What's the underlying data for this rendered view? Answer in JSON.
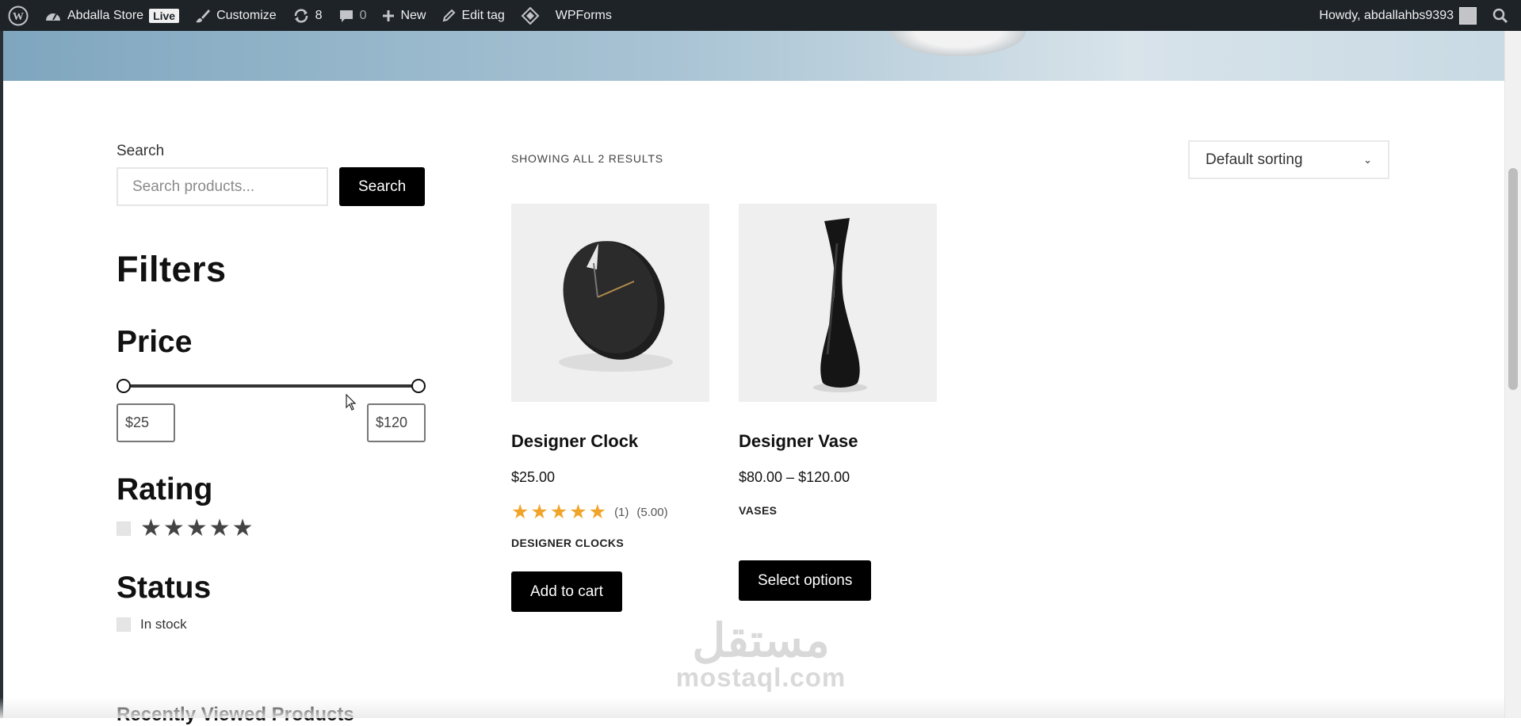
{
  "admin_bar": {
    "site_name": "Abdalla Store",
    "live_badge": "Live",
    "customize": "Customize",
    "updates_count": "8",
    "comments_count": "0",
    "new_label": "New",
    "edit_tag": "Edit tag",
    "wpforms": "WPForms",
    "howdy": "Howdy, abdallahbs9393",
    "icons": [
      "wordpress-logo-icon",
      "dashboard-icon",
      "brush-icon",
      "refresh-icon",
      "comment-icon",
      "plus-icon",
      "pencil-icon",
      "wpforms-icon",
      "avatar",
      "search-icon"
    ]
  },
  "sidebar": {
    "search_label": "Search",
    "search_placeholder": "Search products...",
    "search_button": "Search",
    "filters_title": "Filters",
    "price_title": "Price",
    "price_min": "$25",
    "price_max": "$120",
    "price_range_fraction": [
      0,
      1
    ],
    "rating_title": "Rating",
    "rating_stars": "★★★★★",
    "status_title": "Status",
    "in_stock_label": "In stock",
    "recently_viewed": "Recently Viewed Products"
  },
  "shop": {
    "results_count": "SHOWING ALL 2 RESULTS",
    "sorting_selected": "Default sorting",
    "products": [
      {
        "name": "Designer Clock",
        "price": "$25.00",
        "stars": "★★★★★",
        "review_count": "(1)",
        "rating_value": "(5.00)",
        "category": "DESIGNER CLOCKS",
        "button": "Add to cart"
      },
      {
        "name": "Designer Vase",
        "price": "$80.00 – $120.00",
        "category": "VASES",
        "button": "Select options"
      }
    ]
  },
  "watermark": {
    "arabic": "مستقل",
    "latin": "mostaql.com"
  },
  "colors": {
    "admin_bar_bg": "#1d2327",
    "button_bg": "#000000",
    "star_gold": "#f0a52a"
  }
}
